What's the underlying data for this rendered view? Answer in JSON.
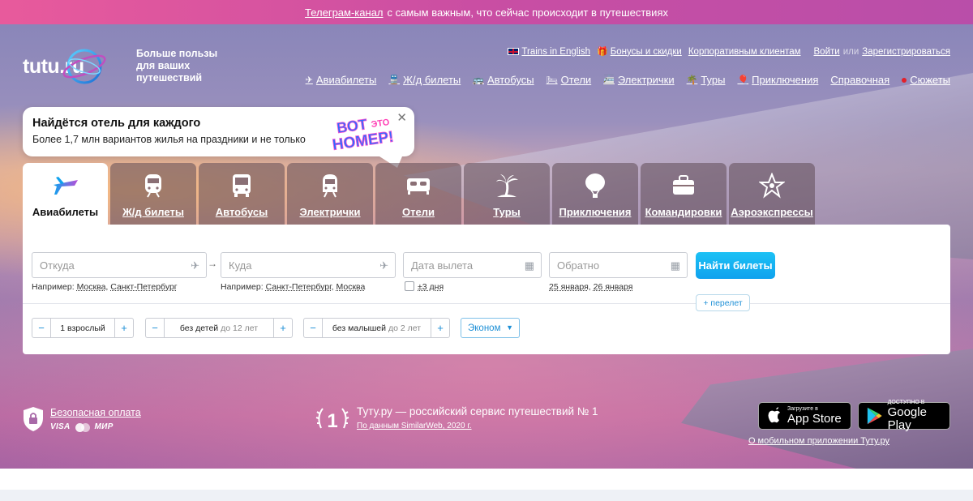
{
  "promo_bar": {
    "link": "Телеграм-канал",
    "text": "с самым важным, что сейчас происходит в путешествиях"
  },
  "logo": {
    "text": "tutu.ru",
    "tagline": "Больше пользы для ваших путешествий"
  },
  "top_links": {
    "english": "Trains in English",
    "bonuses": "Бонусы и скидки",
    "corporate": "Корпоративным клиентам",
    "login": "Войти",
    "or": "или",
    "register": "Зарегистрироваться"
  },
  "nav": [
    {
      "label": "Авиабилеты",
      "icon": "plane-icon"
    },
    {
      "label": "Ж/д билеты",
      "icon": "train-icon"
    },
    {
      "label": "Автобусы",
      "icon": "bus-icon"
    },
    {
      "label": "Отели",
      "icon": "bed-icon"
    },
    {
      "label": "Электрички",
      "icon": "suburban-train-icon"
    },
    {
      "label": "Туры",
      "icon": "palm-icon"
    },
    {
      "label": "Приключения",
      "icon": "balloon-icon"
    },
    {
      "label": "Справочная",
      "icon": ""
    },
    {
      "label": "Сюжеты",
      "icon": "red-dot-icon"
    }
  ],
  "promo_card": {
    "title": "Найдётся отель для каждого",
    "subtitle": "Более 1,7 млн вариантов жилья на праздники и не только",
    "sticker_line1": "ВОТ",
    "sticker_line2": "ЭТО",
    "sticker_line3": "НОМЕР!"
  },
  "tabs": [
    {
      "label": "Авиабилеты",
      "icon": "plane-icon",
      "active": true
    },
    {
      "label": "Ж/д билеты",
      "icon": "train-icon",
      "active": false
    },
    {
      "label": "Автобусы",
      "icon": "bus-icon",
      "active": false
    },
    {
      "label": "Электрички",
      "icon": "suburban-train-icon",
      "active": false
    },
    {
      "label": "Отели",
      "icon": "bed-icon",
      "active": false
    },
    {
      "label": "Туры",
      "icon": "palm-icon",
      "active": false
    },
    {
      "label": "Приключения",
      "icon": "balloon-icon",
      "active": false
    },
    {
      "label": "Командировки",
      "icon": "briefcase-icon",
      "active": false
    },
    {
      "label": "Аэроэкспрессы",
      "icon": "aeroexpress-icon",
      "active": false
    }
  ],
  "search": {
    "from_placeholder": "Откуда",
    "from_hint_prefix": "Например:",
    "from_hint_1": "Москва",
    "from_hint_2": "Санкт-Петербург",
    "to_placeholder": "Куда",
    "to_hint_prefix": "Например:",
    "to_hint_1": "Санкт-Петербург",
    "to_hint_2": "Москва",
    "depart_placeholder": "Дата вылета",
    "flex_days": "±3 дня",
    "return_placeholder": "Обратно",
    "return_hint_1": "25 января",
    "return_hint_2": "26 января",
    "submit": "Найти билеты",
    "add_flight": "+ перелет",
    "adults": "1 взрослый",
    "children": "без детей",
    "children_muted": "до 12 лет",
    "infants": "без малышей",
    "infants_muted": "до 2 лет",
    "minus": "−",
    "plus": "+",
    "cabin_class": "Эконом"
  },
  "footer": {
    "secure_payment": "Безопасная оплата",
    "visa": "VISA",
    "mir": "МИР",
    "rank": "1",
    "rating_text": "Туту.ру — российский сервис путешествий № 1",
    "rating_source": "По данным SimilarWeb, 2020 г.",
    "appstore_small": "Загрузите в",
    "appstore_big": "App Store",
    "googleplay_small": "ДОСТУПНО В",
    "googleplay_big": "Google Play",
    "app_link": "О мобильном приложении Туту.ру"
  },
  "colors": {
    "accent": "#1d8fd6",
    "button": "#12aef2",
    "alert": "#e3202a",
    "promo_bar": "#d152a0"
  }
}
